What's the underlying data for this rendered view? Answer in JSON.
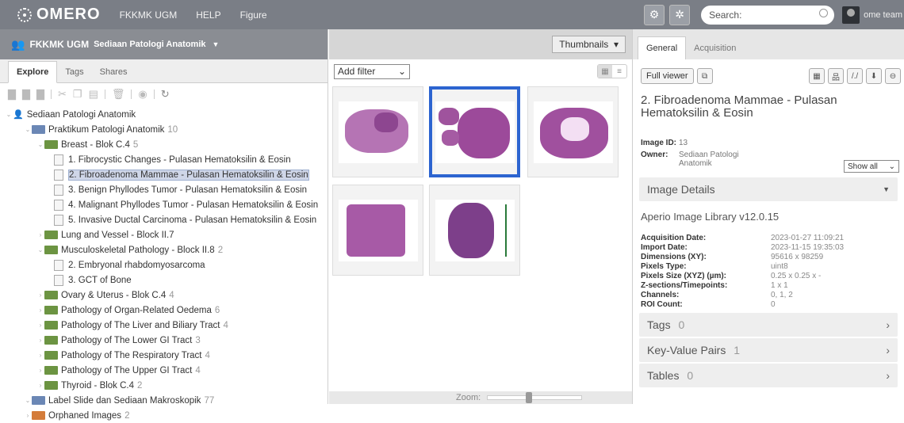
{
  "topbar": {
    "logo": "OMERO",
    "nav": [
      "FKKMK UGM",
      "HELP",
      "Figure"
    ],
    "search_placeholder": "Search:",
    "user": "ome team"
  },
  "left": {
    "group": "FKKMK UGM",
    "user_view": "Sediaan Patologi Anatomik",
    "tabs": [
      "Explore",
      "Tags",
      "Shares"
    ],
    "tree": [
      {
        "label": "Sediaan Patologi Anatomik",
        "count": "",
        "level": 0,
        "kind": "user"
      },
      {
        "label": "Praktikum Patologi Anatomik",
        "count": "10",
        "level": 1,
        "kind": "project"
      },
      {
        "label": "Breast - Blok C.4",
        "count": "5",
        "level": 2,
        "kind": "dataset"
      },
      {
        "label": "1. Fibrocystic Changes - Pulasan Hematoksilin & Eosin",
        "count": "",
        "level": 3,
        "kind": "image"
      },
      {
        "label": "2. Fibroadenoma Mammae - Pulasan Hematoksilin & Eosin",
        "count": "",
        "level": 3,
        "kind": "image",
        "selected": true
      },
      {
        "label": "3. Benign Phyllodes Tumor - Pulasan Hematoksilin & Eosin",
        "count": "",
        "level": 3,
        "kind": "image"
      },
      {
        "label": "4. Malignant Phyllodes Tumor - Pulasan Hematoksilin & Eosin",
        "count": "",
        "level": 3,
        "kind": "image"
      },
      {
        "label": "5. Invasive Ductal Carcinoma - Pulasan Hematoksilin & Eosin",
        "count": "",
        "level": 3,
        "kind": "image"
      },
      {
        "label": "Lung and Vessel - Block II.7",
        "count": "",
        "level": 2,
        "kind": "dataset"
      },
      {
        "label": "Musculoskeletal Pathology - Block II.8",
        "count": "2",
        "level": 2,
        "kind": "dataset"
      },
      {
        "label": "2. Embryonal rhabdomyosarcoma",
        "count": "",
        "level": 3,
        "kind": "image"
      },
      {
        "label": "3. GCT of Bone",
        "count": "",
        "level": 3,
        "kind": "image"
      },
      {
        "label": "Ovary & Uterus - Blok C.4",
        "count": "4",
        "level": 2,
        "kind": "dataset"
      },
      {
        "label": "Pathology of Organ-Related Oedema",
        "count": "6",
        "level": 2,
        "kind": "dataset"
      },
      {
        "label": "Pathology of The Liver and Biliary Tract",
        "count": "4",
        "level": 2,
        "kind": "dataset"
      },
      {
        "label": "Pathology of The Lower GI Tract",
        "count": "3",
        "level": 2,
        "kind": "dataset"
      },
      {
        "label": "Pathology of The Respiratory Tract",
        "count": "4",
        "level": 2,
        "kind": "dataset"
      },
      {
        "label": "Pathology of The Upper GI Tract",
        "count": "4",
        "level": 2,
        "kind": "dataset"
      },
      {
        "label": "Thyroid - Blok C.4",
        "count": "2",
        "level": 2,
        "kind": "dataset"
      },
      {
        "label": "Label Slide dan Sediaan Makroskopik",
        "count": "77",
        "level": 1,
        "kind": "project"
      },
      {
        "label": "Orphaned Images",
        "count": "2",
        "level": 1,
        "kind": "orphan"
      }
    ]
  },
  "center": {
    "view_mode": "Thumbnails",
    "filter": "Add filter",
    "zoom_label": "Zoom:"
  },
  "right": {
    "tabs": [
      "General",
      "Acquisition"
    ],
    "full_viewer": "Full viewer",
    "title": "2. Fibroadenoma Mammae - Pulasan Hematoksilin & Eosin",
    "image_id_label": "Image ID:",
    "image_id": "13",
    "owner_label": "Owner:",
    "owner": "Sediaan Patologi Anatomik",
    "show_all": "Show all",
    "image_details": "Image Details",
    "library": "Aperio Image Library v12.0.15",
    "acquisition": [
      {
        "k": "Acquisition Date:",
        "v": "2023-01-27 11:09:21"
      },
      {
        "k": "Import Date:",
        "v": "2023-11-15 19:35:03"
      },
      {
        "k": "Dimensions (XY):",
        "v": "95616 x 98259"
      },
      {
        "k": "Pixels Type:",
        "v": "uint8"
      },
      {
        "k": "Pixels Size (XYZ) (µm):",
        "v": "0.25 x 0.25 x -"
      },
      {
        "k": "Z-sections/Timepoints:",
        "v": "1 x 1"
      },
      {
        "k": "Channels:",
        "v": "0, 1, 2"
      },
      {
        "k": "ROI Count:",
        "v": "0"
      }
    ],
    "sections": [
      {
        "label": "Tags",
        "count": "0"
      },
      {
        "label": "Key-Value Pairs",
        "count": "1"
      },
      {
        "label": "Tables",
        "count": "0"
      }
    ]
  }
}
